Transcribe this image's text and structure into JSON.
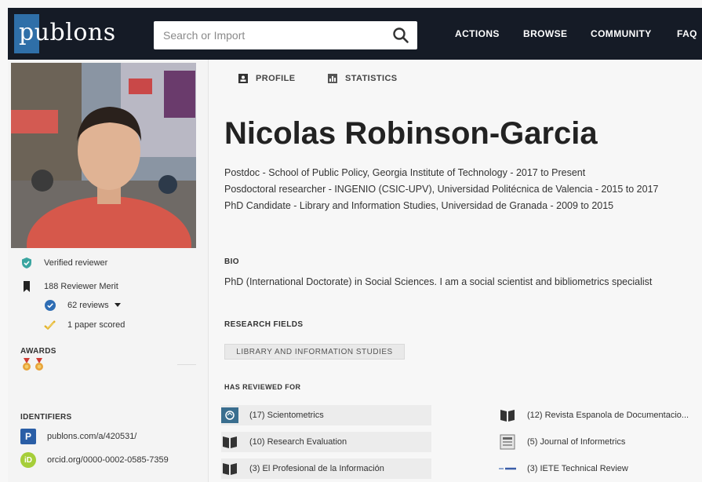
{
  "brand": {
    "logo_text": "publons",
    "accent": "#2f6fa8",
    "topbar_color": "#151b26"
  },
  "search": {
    "placeholder": "Search or Import",
    "icon": "search-icon"
  },
  "nav": {
    "actions": "ACTIONS",
    "browse": "BROWSE",
    "community": "COMMUNITY",
    "faq": "FAQ"
  },
  "sidebar": {
    "avatar_alt": "profile-photo",
    "stats": {
      "verified": "Verified reviewer",
      "merit": "188 Reviewer Merit",
      "reviews": "62 reviews",
      "papers": "1 paper scored"
    },
    "awards_label": "AWARDS",
    "identifiers_label": "IDENTIFIERS",
    "identifiers": {
      "publons": "publons.com/a/420531/",
      "orcid": "orcid.org/0000-0002-0585-7359"
    }
  },
  "tabs": {
    "profile": "PROFILE",
    "statistics": "STATISTICS"
  },
  "profile": {
    "name": "Nicolas Robinson-Garcia",
    "positions": [
      "Postdoc - School of Public Policy, Georgia Institute of Technology - 2017 to Present",
      "Posdoctoral researcher - INGENIO (CSIC-UPV), Universidad Politécnica de Valencia - 2015 to 2017",
      "PhD Candidate - Library and Information Studies, Universidad de Granada - 2009 to 2015"
    ],
    "bio_label": "BIO",
    "bio": "PhD (International Doctorate) in Social Sciences. I am a social scientist and bibliometrics specialist",
    "research_fields_label": "RESEARCH FIELDS",
    "research_field": "LIBRARY AND INFORMATION STUDIES",
    "reviewed_label": "HAS REVIEWED FOR",
    "journals_left": [
      "(17) Scientometrics",
      "(10) Research Evaluation",
      "(3) El Profesional de la Información"
    ],
    "journals_right": [
      "(12) Revista Espanola de Documentacio...",
      "(5) Journal of Informetrics",
      "(3) IETE Technical Review"
    ]
  }
}
